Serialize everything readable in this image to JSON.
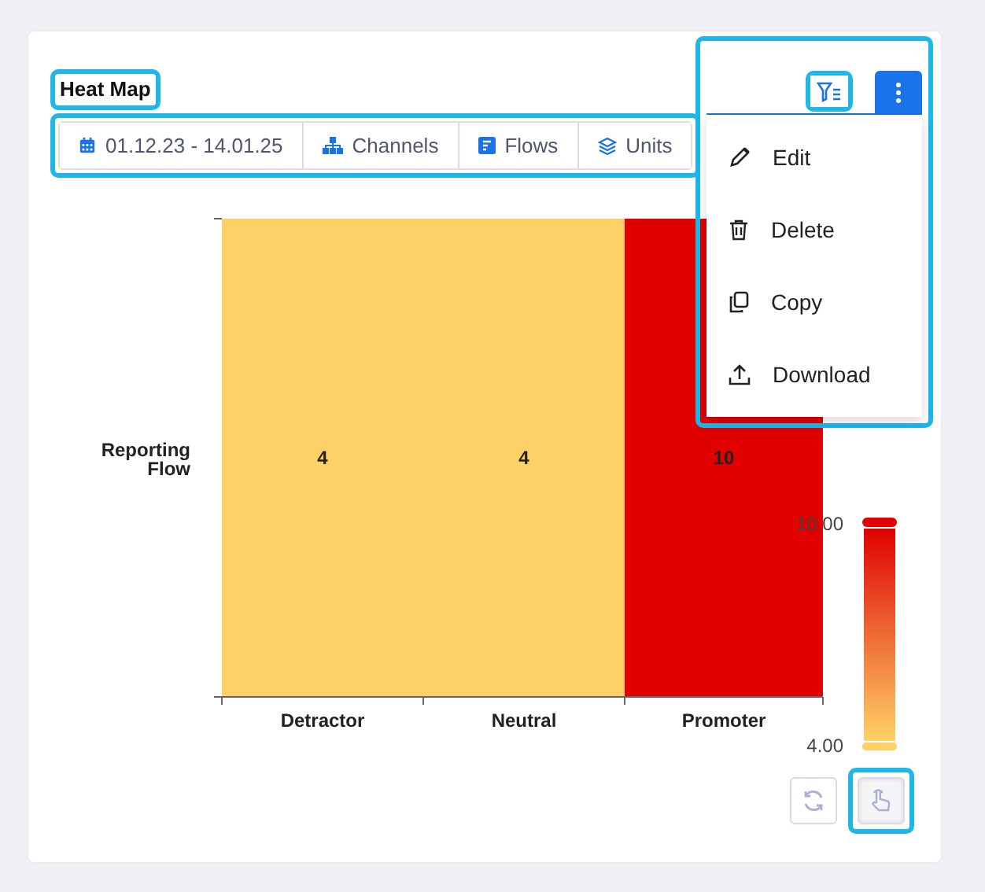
{
  "title": "Heat Map",
  "filters": [
    {
      "kind": "date",
      "label": "01.12.23 - 14.01.25"
    },
    {
      "kind": "channels",
      "label": "Channels"
    },
    {
      "kind": "flows",
      "label": "Flows"
    },
    {
      "kind": "units",
      "label": "Units"
    }
  ],
  "heatmap": {
    "row_label": [
      "Reporting",
      "Flow"
    ],
    "columns": [
      "Detractor",
      "Neutral",
      "Promoter"
    ],
    "cells": [
      {
        "value": "4",
        "color": "#fed166"
      },
      {
        "value": "4",
        "color": "#fed166"
      },
      {
        "value": "10",
        "color": "#e00000"
      }
    ],
    "legend": {
      "max": "10.00",
      "min": "4.00"
    }
  },
  "menu": [
    {
      "kind": "edit",
      "label": "Edit"
    },
    {
      "kind": "delete",
      "label": "Delete"
    },
    {
      "kind": "copy",
      "label": "Copy"
    },
    {
      "kind": "download",
      "label": "Download"
    }
  ]
}
